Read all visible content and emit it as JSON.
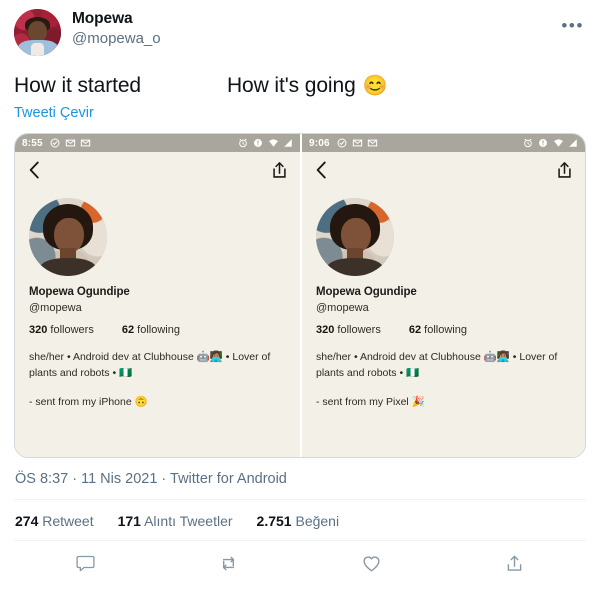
{
  "tweet": {
    "author": {
      "display_name": "Mopewa",
      "handle": "@mopewa_o",
      "avatar_icon": "avatar-photo"
    },
    "more_options_icon": "more-options-icon",
    "text_left": "How it started",
    "text_right": "How it's going",
    "text_right_emoji": "😊",
    "translate_label": "Tweeti Çevir",
    "meta": "ÖS 8:37 · 11 Nis 2021 · Twitter for Android"
  },
  "media": {
    "left": {
      "status_time": "8:55",
      "back_icon": "back-chevron-icon",
      "share_icon": "share-upload-icon",
      "profile_photo_icon": "profile-photo",
      "name": "Mopewa Ogundipe",
      "handle": "@mopewa",
      "followers_count": "320",
      "followers_label": "followers",
      "following_count": "62",
      "following_label": "following",
      "bio_line1": "she/her • Android dev at Clubhouse 🤖👩🏽‍💻 • Lover of",
      "bio_line2": "plants and robots • 🇳🇬",
      "sent_from": "- sent from my iPhone 🙃"
    },
    "right": {
      "status_time": "9:06",
      "back_icon": "back-chevron-icon",
      "share_icon": "share-upload-icon",
      "profile_photo_icon": "profile-photo",
      "name": "Mopewa Ogundipe",
      "handle": "@mopewa",
      "followers_count": "320",
      "followers_label": "followers",
      "following_count": "62",
      "following_label": "following",
      "bio_line1": "she/her • Android dev at Clubhouse 🤖👩🏽‍💻 • Lover of",
      "bio_line2": "plants and robots • 🇳🇬",
      "sent_from": "- sent from my Pixel 🎉"
    }
  },
  "stats": [
    {
      "count": "274",
      "label": "Retweet"
    },
    {
      "count": "171",
      "label": "Alıntı Tweetler"
    },
    {
      "count": "2.751",
      "label": "Beğeni"
    }
  ],
  "actions": [
    {
      "name": "reply-action",
      "icon": "reply-icon"
    },
    {
      "name": "retweet-action",
      "icon": "retweet-icon"
    },
    {
      "name": "like-action",
      "icon": "heart-icon"
    },
    {
      "name": "share-action",
      "icon": "share-icon"
    }
  ],
  "colors": {
    "link_blue": "#1b95e0",
    "text_primary": "#0f1419",
    "text_secondary": "#5b7083",
    "card_bg": "#f3f1e7",
    "statusbar": "#a9a69d"
  }
}
